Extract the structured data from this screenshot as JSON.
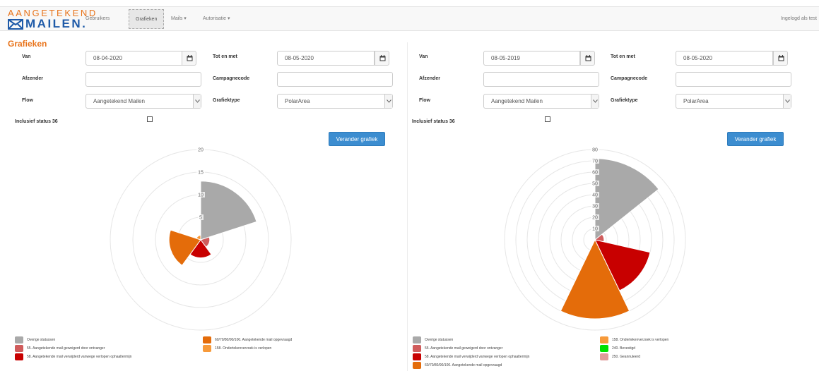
{
  "brand": {
    "top": "AANGETEKEND",
    "bottom": "MAILEN."
  },
  "nav": {
    "items": [
      {
        "label": "Gebruikers"
      },
      {
        "label": "Grafieken"
      },
      {
        "label": "Mails ▾"
      },
      {
        "label": "Autorisatie ▾"
      }
    ],
    "user": "Ingelogd als test"
  },
  "page": {
    "title": "Grafieken"
  },
  "panels": [
    {
      "van_label": "Van",
      "van_value": "08-04-2020",
      "tot_label": "Tot en met",
      "tot_value": "08-05-2020",
      "afzender_label": "Afzender",
      "afzender_value": "",
      "campagne_label": "Campagnecode",
      "campagne_value": "",
      "flow_label": "Flow",
      "flow_value": "Aangetekend Mailen",
      "type_label": "Grafiektype",
      "type_value": "PolarArea",
      "status_label": "Inclusief status 36",
      "button_label": "Verander grafiek"
    },
    {
      "van_label": "Van",
      "van_value": "08-05-2019",
      "tot_label": "Tot en met",
      "tot_value": "08-05-2020",
      "afzender_label": "Afzender",
      "afzender_value": "",
      "campagne_label": "Campagnecode",
      "campagne_value": "",
      "flow_label": "Flow",
      "flow_value": "Aangetekend Mailen",
      "type_label": "Grafiektype",
      "type_value": "PolarArea",
      "status_label": "Inclusief status 36",
      "button_label": "Verander grafiek"
    }
  ],
  "chart_data": [
    {
      "type": "polarArea",
      "rmax": 20,
      "ticks": [
        5,
        10,
        15,
        20
      ],
      "tick_labels": [
        "5",
        "10",
        "15",
        "20"
      ],
      "legend_position": "bottom",
      "series": [
        {
          "name": "Overige statussen",
          "value": 13,
          "color": "#a9a9a9"
        },
        {
          "name": "55. Aangetekende mail geweigerd door ontvanger",
          "value": 2,
          "color": "#d05c5c"
        },
        {
          "name": "58. Aangetekende mail verwijderd vanwege verlopen ophaaltermijn",
          "value": 4,
          "color": "#c80000"
        },
        {
          "name": "60/70/80/90/100. Aangetekende mail opgevraagd",
          "value": 7,
          "color": "#e46c0a"
        },
        {
          "name": "158. Ondertekenverzoek is verlopen",
          "value": 1,
          "color": "#f79a3a"
        }
      ]
    },
    {
      "type": "polarArea",
      "rmax": 80,
      "ticks": [
        10,
        20,
        30,
        40,
        50,
        60,
        70,
        80
      ],
      "tick_labels": [
        "10",
        "20",
        "30",
        "40",
        "50",
        "60",
        "70",
        "80"
      ],
      "legend_position": "bottom",
      "series": [
        {
          "name": "Overige statussen",
          "value": 72,
          "color": "#a9a9a9"
        },
        {
          "name": "55. Aangetekende mail geweigerd door ontvanger",
          "value": 8,
          "color": "#d05c5c"
        },
        {
          "name": "58. Aangetekende mail verwijderd vanwege verlopen ophaaltermijn",
          "value": 50,
          "color": "#c80000"
        },
        {
          "name": "60/70/80/90/100. Aangetekende mail opgevraagd",
          "value": 70,
          "color": "#e46c0a"
        },
        {
          "name": "158. Ondertekenverzoek is verlopen",
          "value": 1,
          "color": "#f79a3a"
        },
        {
          "name": "240. Bevestigd",
          "value": 1,
          "color": "#00e000"
        },
        {
          "name": "250. Geannuleerd",
          "value": 1,
          "color": "#e09a9a"
        }
      ]
    }
  ]
}
